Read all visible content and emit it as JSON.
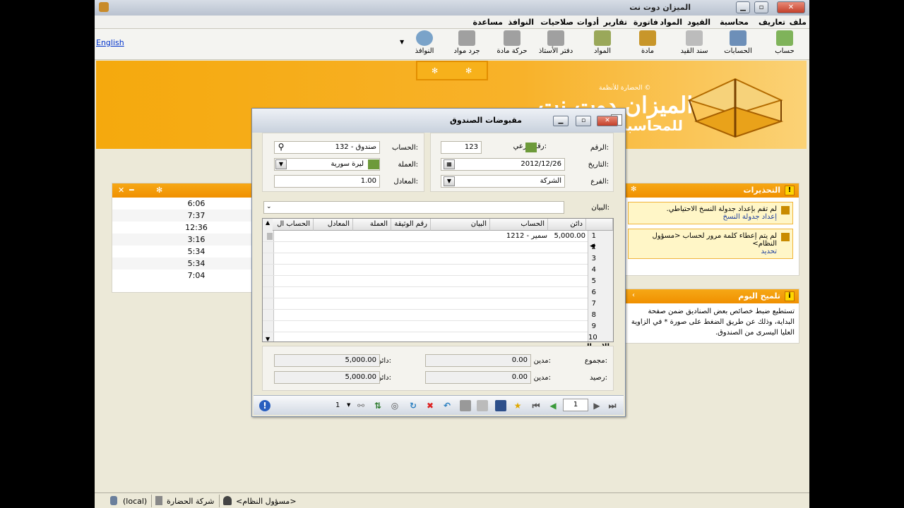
{
  "window": {
    "title": "الميزان دوت نت"
  },
  "menu": [
    "ملف",
    "تعاريف",
    "محاسبة",
    "القيود",
    "المواد",
    "فاتورة",
    "تقارير",
    "أدوات",
    "صلاحيات",
    "النوافذ",
    "مساعدة"
  ],
  "toolbar": {
    "english": "English",
    "buttons": [
      "حساب",
      "الحسابات",
      "سند القيد",
      "مادة",
      "المواد",
      "دفتر الأستاذ",
      "حركة مادة",
      "جرد مواد",
      "النوافذ"
    ]
  },
  "banner": {
    "brand": "الميزان دوت نت",
    "brand2": "للمحاسبة",
    "small": "الحضارة للأنظمة ©"
  },
  "left_panel": {
    "times": [
      "6:06",
      "7:37",
      "12:36",
      "3:16",
      "5:34",
      "5:34",
      "7:04"
    ]
  },
  "alerts": {
    "title": "التحذيرات",
    "items": [
      {
        "text": "لم تقم بإعداد جدولة النسخ الاحتياطي.",
        "link": "إعداد جدولة النسخ"
      },
      {
        "text": "لم يتم إعطاء كلمة مرور لحساب <مسؤول النظام>",
        "link": "تحديد"
      }
    ]
  },
  "tip": {
    "title": "تلميح اليوم",
    "text": "تستطيع ضبط خصائص بعض الصناديق ضمن صفحة البداية، وذلك عن طريق الضغط على صورة * في الزاوية العليا اليسرى من الصندوق."
  },
  "dialog": {
    "title": "مقبوضات الصندوق",
    "labels": {
      "number": "الرقم:",
      "sub_number": "رقم فرعي:",
      "date": "التاريخ:",
      "branch": "الفرع:",
      "account": "الحساب:",
      "currency": "العملة:",
      "rate": "المعادل:",
      "statement": "البيان:",
      "total": "الإجمالي",
      "sum": "مجموع:",
      "balance": "رصيد:",
      "debit": "مدين:",
      "credit": "دائن:"
    },
    "values": {
      "sub_number": "123",
      "date": "2012/12/26",
      "branch": "الشركة",
      "account": "132 - صندوق",
      "currency": "ليرة سورية",
      "rate": "1.00",
      "sum_debit": "0.00",
      "sum_credit": "5,000.00",
      "bal_debit": "0.00",
      "bal_credit": "5,000.00"
    },
    "grid": {
      "columns": [
        "دائن",
        "الحساب",
        "البيان",
        "رقم الوثيقة",
        "العملة",
        "المعادل",
        "الحساب ال"
      ],
      "rows": [
        {
          "n": "1",
          "credit": "5,000.00",
          "account": "1212 - سمير"
        },
        {
          "n": "2"
        },
        {
          "n": "3"
        },
        {
          "n": "4"
        },
        {
          "n": "5"
        },
        {
          "n": "6"
        },
        {
          "n": "7"
        },
        {
          "n": "8"
        },
        {
          "n": "9"
        },
        {
          "n": "10"
        }
      ]
    },
    "pager": {
      "page": "1",
      "count": "1"
    }
  },
  "status": {
    "user": "<مسؤول النظام>",
    "company": "شركة الحضارة",
    "server": "(local)"
  }
}
